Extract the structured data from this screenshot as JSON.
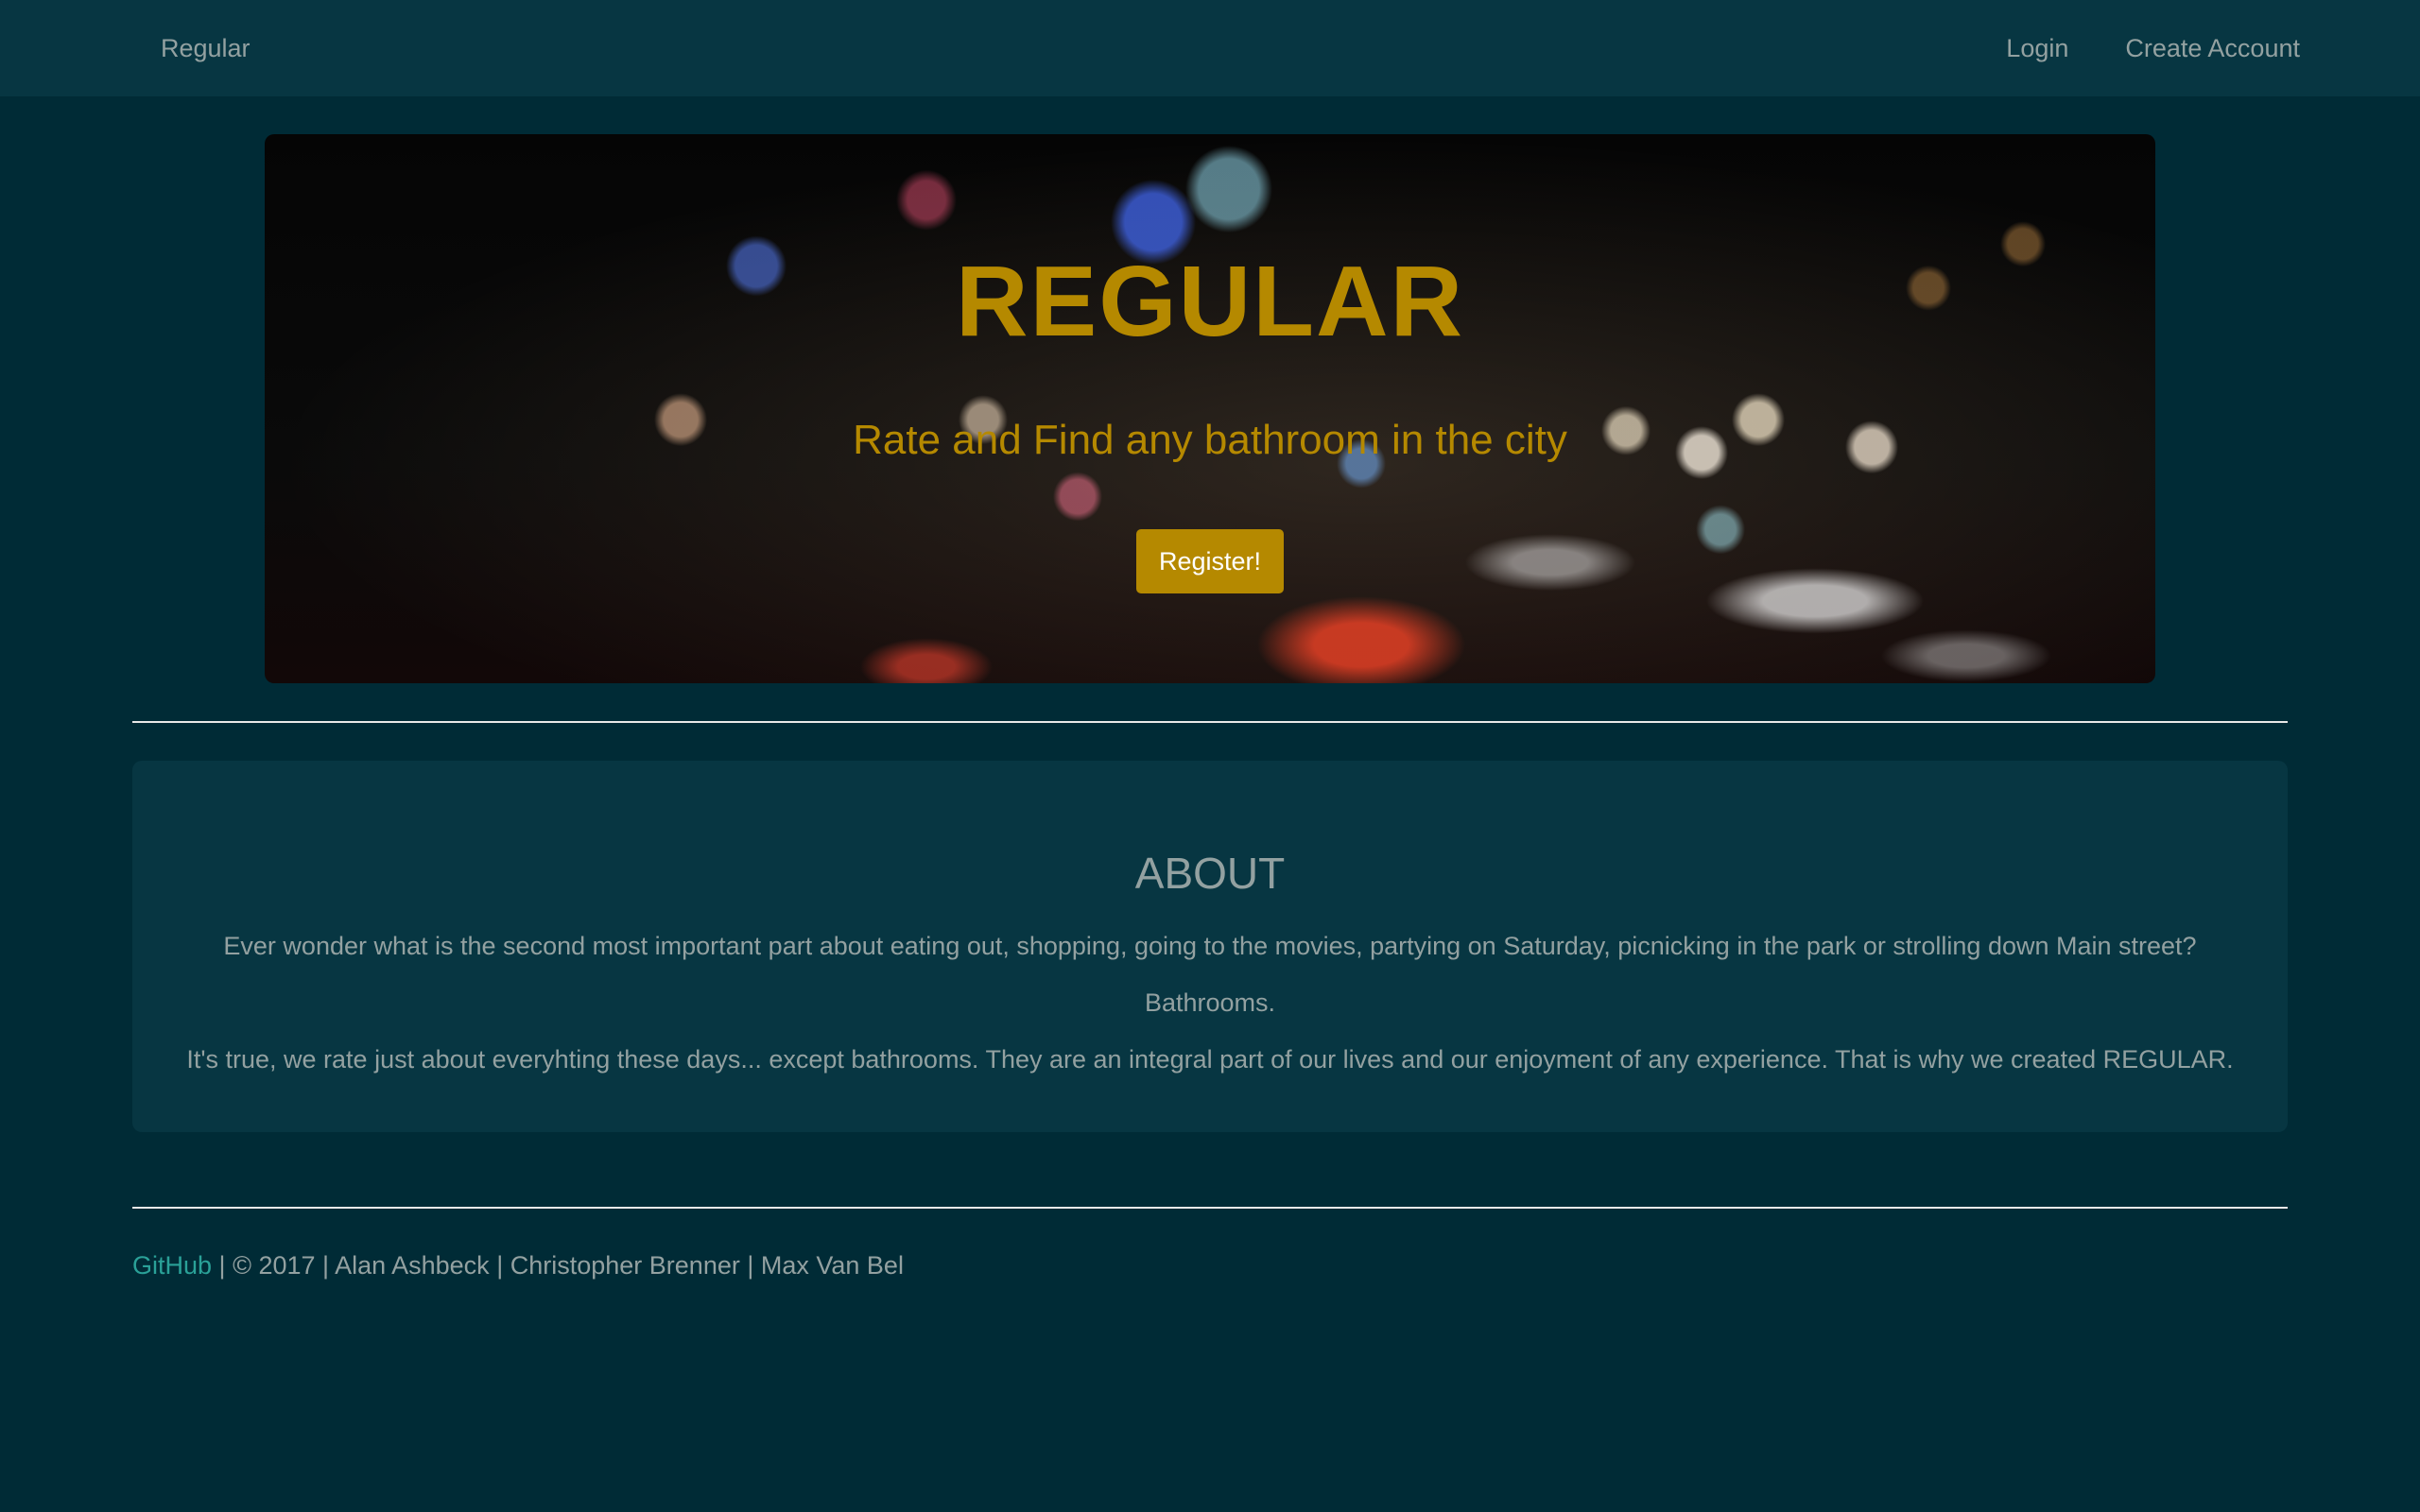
{
  "navbar": {
    "brand": "Regular",
    "links": [
      "Login",
      "Create Account"
    ]
  },
  "hero": {
    "title": "REGULAR",
    "subtitle": "Rate and Find any bathroom in the city",
    "button_label": "Register!"
  },
  "about": {
    "title": "ABOUT",
    "paragraphs": [
      "Ever wonder what is the second most important part about eating out, shopping, going to the movies, partying on Saturday, picnicking in the park or strolling down Main street?",
      "Bathrooms.",
      "It's true, we rate just about everyhting these days... except bathrooms. They are an integral part of our lives and our enjoyment of any experience. That is why we created REGULAR."
    ]
  },
  "footer": {
    "link_text": "GitHub",
    "separator": " | ",
    "items": [
      "© 2017",
      "Alan Ashbeck",
      "Christopher Brenner",
      "Max Van Bel"
    ]
  },
  "colors": {
    "background": "#002b36",
    "panel": "#073642",
    "accent": "#b58900",
    "text": "#93a1a1",
    "link": "#2aa198"
  }
}
